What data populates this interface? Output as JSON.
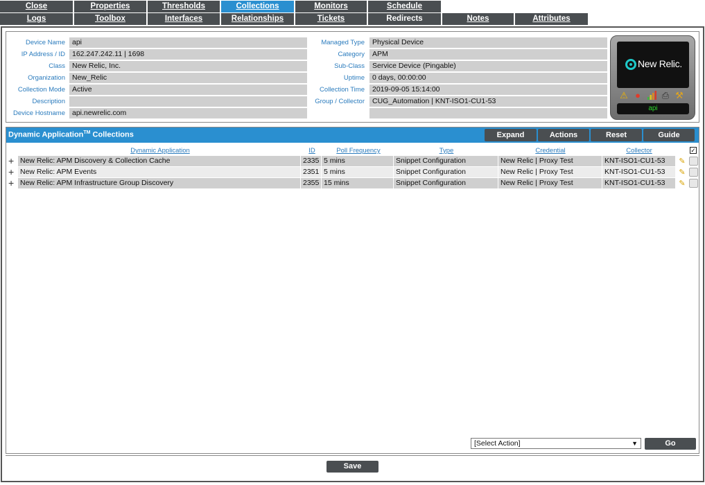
{
  "tabs_row1": [
    "Close",
    "Properties",
    "Thresholds",
    "Collections",
    "Monitors",
    "Schedule"
  ],
  "tabs_row2": [
    "Logs",
    "Toolbox",
    "Interfaces",
    "Relationships",
    "Tickets",
    "Redirects",
    "Notes",
    "Attributes"
  ],
  "active_tab": "Collections",
  "device": {
    "labels_left": [
      "Device Name",
      "IP Address / ID",
      "Class",
      "Organization",
      "Collection Mode",
      "Description",
      "Device Hostname"
    ],
    "values_left": [
      "api",
      "162.247.242.11 | 1698",
      "New Relic, Inc.",
      "New_Relic",
      "Active",
      "",
      "api.newrelic.com"
    ],
    "labels_right": [
      "Managed Type",
      "Category",
      "Sub-Class",
      "Uptime",
      "Collection Time",
      "Group / Collector",
      ""
    ],
    "values_right": [
      "Physical Device",
      "APM",
      "Service Device (Pingable)",
      "0 days, 00:00:00",
      "2019-09-05 15:14:00",
      "CUG_Automation | KNT-ISO1-CU1-53",
      ""
    ]
  },
  "logo": {
    "brand": "New Relic.",
    "device_name": "api",
    "icons": [
      "warning-icon",
      "lifebuoy-icon",
      "signal-bars-icon",
      "printer-icon",
      "wrench-icon"
    ]
  },
  "panel": {
    "title": "Dynamic Application",
    "title_sup": "TM",
    "title_suffix": " Collections",
    "buttons": [
      "Expand",
      "Actions",
      "Reset",
      "Guide"
    ]
  },
  "table": {
    "headers": [
      "Dynamic Application",
      "ID",
      "Poll Frequency",
      "Type",
      "Credential",
      "Collector"
    ],
    "rows": [
      [
        "New Relic: APM Discovery & Collection Cache",
        "2335",
        "5 mins",
        "Snippet Configuration",
        "New Relic | Proxy Test",
        "KNT-ISO1-CU1-53"
      ],
      [
        "New Relic: APM Events",
        "2351",
        "5 mins",
        "Snippet Configuration",
        "New Relic | Proxy Test",
        "KNT-ISO1-CU1-53"
      ],
      [
        "New Relic: APM Infrastructure Group Discovery",
        "2355",
        "15 mins",
        "Snippet Configuration",
        "New Relic | Proxy Test",
        "KNT-ISO1-CU1-53"
      ]
    ]
  },
  "select_action": "[Select Action]",
  "go_label": "Go",
  "save_label": "Save",
  "colors": {
    "tab_bg": "#4a4e51",
    "active_tab": "#2a8fd0",
    "label_blue": "#2a7bbd",
    "value_bg": "#cfcfcf"
  }
}
